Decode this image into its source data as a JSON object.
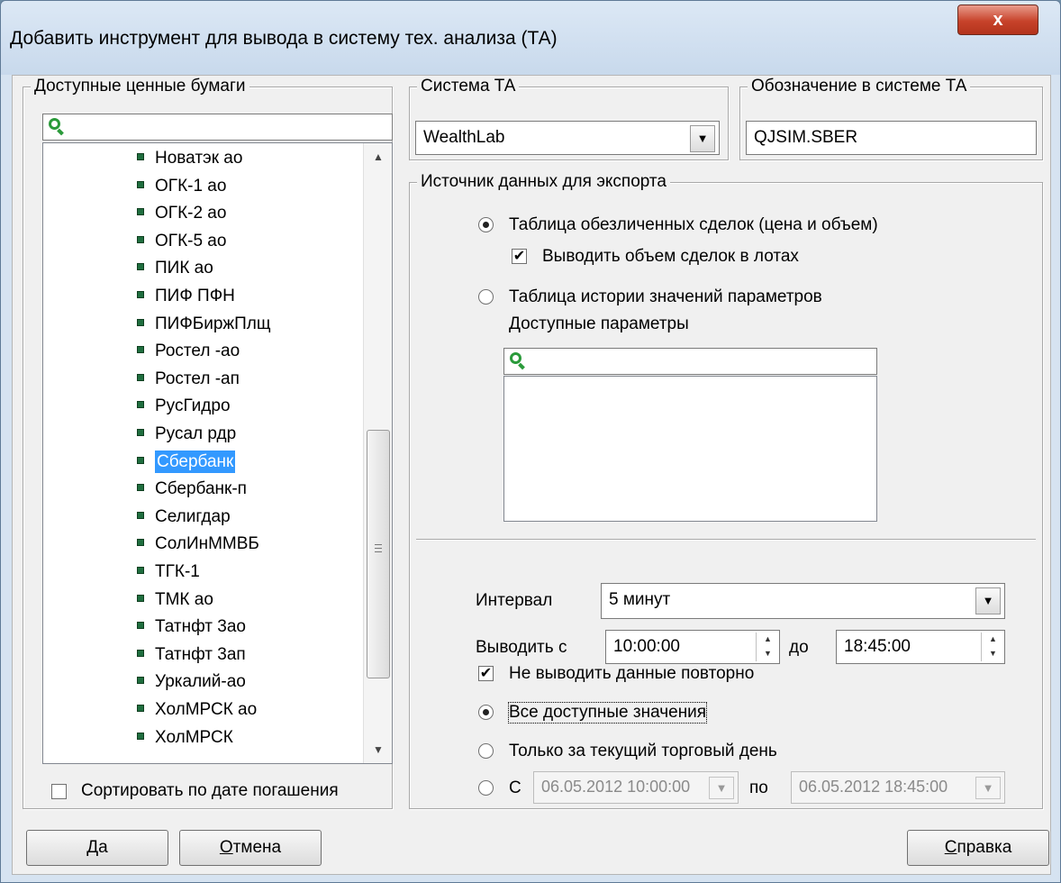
{
  "window": {
    "title": "Добавить инструмент для вывода в систему тех. анализа (ТА)",
    "close_label": "x"
  },
  "securities": {
    "group_label": "Доступные ценные бумаги",
    "search_value": "",
    "items": [
      "Новатэк ао",
      "ОГК-1 ао",
      "ОГК-2 ао",
      "ОГК-5 ао",
      "ПИК ао",
      "ПИФ ПФН",
      "ПИФБиржПлщ",
      "Ростел -ао",
      "Ростел -ап",
      "РусГидро",
      "Русал рдр",
      "Сбербанк",
      "Сбербанк-п",
      "Селигдар",
      "СолИнММВБ",
      "ТГК-1",
      "ТМК ао",
      "Татнфт 3ао",
      "Татнфт 3ап",
      "Уркалий-ао",
      "ХолМРСК ао",
      "ХолМРСК"
    ],
    "selected_item": "Сбербанк",
    "sort_label": "Сортировать по дате погашения",
    "sort_checked": false
  },
  "ta_system": {
    "group_label": "Система ТА",
    "value": "WealthLab"
  },
  "designation": {
    "group_label": "Обозначение в системе ТА",
    "value": "QJSIM.SBER"
  },
  "source": {
    "group_label": "Источник данных для экспорта",
    "option_trades": "Таблица обезличенных сделок (цена и объем)",
    "option_trades_selected": true,
    "lots_label": "Выводить объем  сделок в лотах",
    "lots_checked": true,
    "option_history": "Таблица истории значений параметров",
    "params_label": "Доступные параметры",
    "params_search_value": ""
  },
  "interval": {
    "label": "Интервал",
    "value": "5 минут"
  },
  "output": {
    "from_label": "Выводить с",
    "from_value": "10:00:00",
    "to_label": "до",
    "to_value": "18:45:00",
    "no_repeat_label": "Не выводить данные повторно",
    "no_repeat_checked": true,
    "all_values_label": "Все доступные значения",
    "today_label": "Только за текущий торговый день",
    "range_from_label": "С",
    "range_from_value": "06.05.2012 10:00:00",
    "range_to_label": "по",
    "range_to_value": "06.05.2012 18:45:00"
  },
  "buttons": {
    "ok_prefix": "Д",
    "ok_rest": "а",
    "cancel_prefix": "О",
    "cancel_rest": "тмена",
    "help_prefix": "С",
    "help_rest": "правка"
  }
}
